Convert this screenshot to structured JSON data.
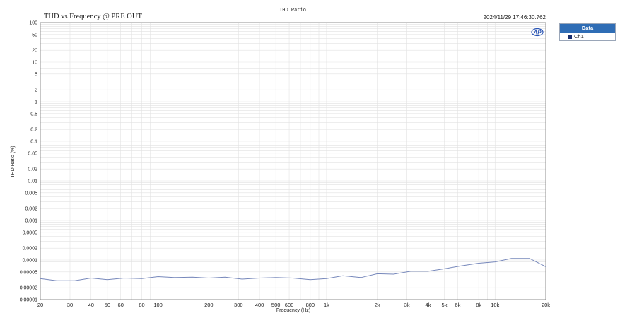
{
  "chart_data": {
    "type": "line",
    "top_label": "THD Ratio",
    "title": "THD vs Frequency @ PRE OUT",
    "timestamp": "2024/11/29 17:46:30.762",
    "xlabel": "Frequency (Hz)",
    "ylabel": "THD Ratio (%)",
    "x_scale": "log",
    "y_scale": "log",
    "xlim": [
      20,
      20000
    ],
    "ylim": [
      1e-05,
      100
    ],
    "grid": true,
    "x_ticks": [
      {
        "value": 20,
        "label": "20"
      },
      {
        "value": 30,
        "label": "30"
      },
      {
        "value": 40,
        "label": "40"
      },
      {
        "value": 50,
        "label": "50"
      },
      {
        "value": 60,
        "label": "60"
      },
      {
        "value": 80,
        "label": "80"
      },
      {
        "value": 100,
        "label": "100"
      },
      {
        "value": 200,
        "label": "200"
      },
      {
        "value": 300,
        "label": "300"
      },
      {
        "value": 400,
        "label": "400"
      },
      {
        "value": 500,
        "label": "500"
      },
      {
        "value": 600,
        "label": "600"
      },
      {
        "value": 800,
        "label": "800"
      },
      {
        "value": 1000,
        "label": "1k"
      },
      {
        "value": 2000,
        "label": "2k"
      },
      {
        "value": 3000,
        "label": "3k"
      },
      {
        "value": 4000,
        "label": "4k"
      },
      {
        "value": 5000,
        "label": "5k"
      },
      {
        "value": 6000,
        "label": "6k"
      },
      {
        "value": 8000,
        "label": "8k"
      },
      {
        "value": 10000,
        "label": "10k"
      },
      {
        "value": 20000,
        "label": "20k"
      }
    ],
    "y_ticks": [
      {
        "value": 100,
        "label": "100"
      },
      {
        "value": 50,
        "label": "50"
      },
      {
        "value": 20,
        "label": "20"
      },
      {
        "value": 10,
        "label": "10"
      },
      {
        "value": 5,
        "label": "5"
      },
      {
        "value": 2,
        "label": "2"
      },
      {
        "value": 1,
        "label": "1"
      },
      {
        "value": 0.5,
        "label": "0.5"
      },
      {
        "value": 0.2,
        "label": "0.2"
      },
      {
        "value": 0.1,
        "label": "0.1"
      },
      {
        "value": 0.05,
        "label": "0.05"
      },
      {
        "value": 0.02,
        "label": "0.02"
      },
      {
        "value": 0.01,
        "label": "0.01"
      },
      {
        "value": 0.005,
        "label": "0.005"
      },
      {
        "value": 0.002,
        "label": "0.002"
      },
      {
        "value": 0.001,
        "label": "0.001"
      },
      {
        "value": 0.0005,
        "label": "0.0005"
      },
      {
        "value": 0.0002,
        "label": "0.0002"
      },
      {
        "value": 0.0001,
        "label": "0.0001"
      },
      {
        "value": 5e-05,
        "label": "0.00005"
      },
      {
        "value": 2e-05,
        "label": "0.00002"
      },
      {
        "value": 1e-05,
        "label": "0.00001"
      }
    ],
    "legend": {
      "title": "Data",
      "placement": "right"
    },
    "series": [
      {
        "name": "Ch1",
        "color": "#7788bb",
        "swatch_color": "#1b2f6e",
        "x": [
          20,
          25,
          32,
          40,
          50,
          63,
          80,
          100,
          125,
          160,
          200,
          250,
          315,
          400,
          500,
          630,
          800,
          1000,
          1250,
          1600,
          2000,
          2500,
          3150,
          4000,
          5000,
          6300,
          8000,
          10000,
          12500,
          16000,
          20000
        ],
        "y": [
          3.4e-05,
          3e-05,
          3e-05,
          3.5e-05,
          3.2e-05,
          3.5e-05,
          3.4e-05,
          3.8e-05,
          3.6e-05,
          3.7e-05,
          3.5e-05,
          3.7e-05,
          3.3e-05,
          3.5e-05,
          3.6e-05,
          3.5e-05,
          3.2e-05,
          3.4e-05,
          4e-05,
          3.6e-05,
          4.5e-05,
          4.4e-05,
          5.2e-05,
          5.2e-05,
          6e-05,
          7.1e-05,
          8.3e-05,
          9e-05,
          0.00011,
          0.00011,
          6.8e-05
        ]
      }
    ]
  },
  "colors": {
    "grid": "#e2e2e2",
    "axis": "#666666",
    "text": "#222222",
    "legend_header": "#2f6db5",
    "logo": "#2a55b5"
  },
  "logo_icon": "ap-logo-icon"
}
